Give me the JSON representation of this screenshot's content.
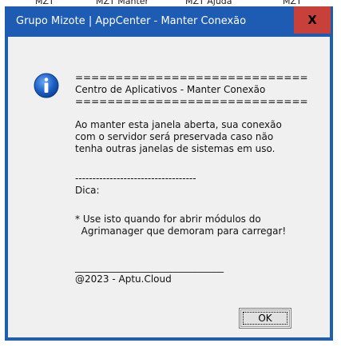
{
  "background_menu": {
    "items": [
      "MZT",
      "MZT Manter",
      "MZT Ajuda",
      "MZT"
    ]
  },
  "dialog": {
    "title": "Grupo Mizote | AppCenter - Manter Conexão",
    "close_label": "X",
    "icon": "information-icon",
    "message_header": "=============================\nCentro de Aplicativos - Manter Conexão\n=============================",
    "message_body": "Ao manter esta janela aberta, sua conexão\ncom o servidor será preservada caso não\ntenha outras janelas de sistemas em uso.",
    "tip_label": "-----------------------------------\nDica:",
    "tip_text": "* Use isto quando for abrir módulos do\n  Agrimanager que demoram para carregar!",
    "footer": "_______________________________\n@2023 - Aptu.Cloud",
    "ok_label": "OK"
  },
  "colors": {
    "titlebar": "#1e5cb4",
    "close_button": "#c7403a",
    "client_background": "#f0f0f0",
    "icon_blue": "#1c5fc7"
  }
}
